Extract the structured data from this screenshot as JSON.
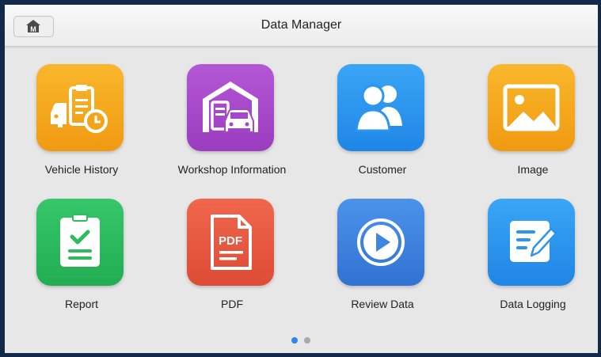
{
  "header": {
    "title": "Data Manager",
    "home_icon_letter": "M"
  },
  "apps": [
    {
      "label": "Vehicle History",
      "icon": "vehicle-history-icon",
      "color": "#f4a419"
    },
    {
      "label": "Workshop Information",
      "icon": "workshop-icon",
      "color": "#a646c8"
    },
    {
      "label": "Customer",
      "icon": "customer-icon",
      "color": "#2c95ef"
    },
    {
      "label": "Image",
      "icon": "image-icon",
      "color": "#f4a419"
    },
    {
      "label": "Report",
      "icon": "report-icon",
      "color": "#2dbb5e"
    },
    {
      "label": "PDF",
      "icon": "pdf-icon",
      "color": "#ea5a42",
      "icon_text": "PDF"
    },
    {
      "label": "Review Data",
      "icon": "review-data-icon",
      "color": "#3f86e0"
    },
    {
      "label": "Data Logging",
      "icon": "data-logging-icon",
      "color": "#2c95ef"
    }
  ],
  "pagination": {
    "current": 1,
    "total": 2,
    "active_color": "#2c87ee",
    "inactive_color": "#aaaaaa"
  }
}
